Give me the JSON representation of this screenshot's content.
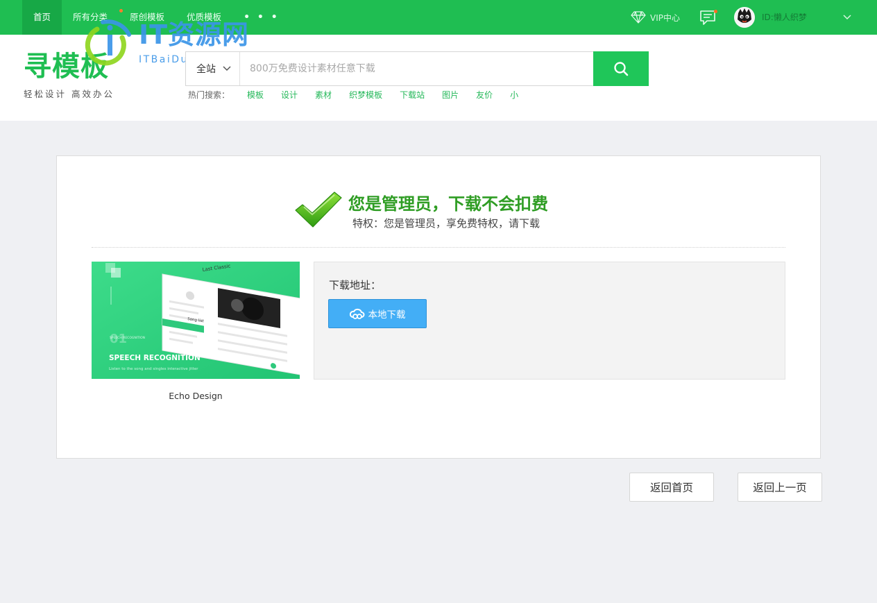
{
  "topnav": {
    "items": [
      "首页",
      "所有分类",
      "原创模板",
      "优质模板"
    ],
    "more": "• • •",
    "vip_label": "VIP中心",
    "user_id": "ID:懒人织梦"
  },
  "header": {
    "logo_title": "寻模板",
    "logo_slogan": "轻松设计 高效办公",
    "watermark_title": "IT资源网",
    "watermark_sub": "ITBaiDu.com",
    "search_scope": "全站",
    "search_placeholder": "800万免费设计素材任意下载",
    "hot_label": "热门搜索：",
    "hot_links": [
      "模板",
      "设计",
      "素材",
      "织梦模板",
      "下载站",
      "图片",
      "友价",
      "小"
    ]
  },
  "notice": {
    "title": "您是管理员，下载不会扣费",
    "subtitle": "特权：您是管理员，享免费特权，请下载"
  },
  "item": {
    "thumb_heading": "SPEECH RECOGNITION",
    "thumb_small": "SPEECH RECOGNITION",
    "thumb_number": "01",
    "thumb_tagline": "Listen to the song and singles interactive jitter",
    "thumb_screen_title": "Last Classic",
    "thumb_screen_song": "Song list",
    "caption": "Echo Design"
  },
  "download": {
    "label": "下载地址：",
    "button": "本地下载"
  },
  "footer": {
    "back_home": "返回首页",
    "back_prev": "返回上一页"
  },
  "colors": {
    "brand_green": "#1fbe52",
    "notice_green": "#2f9d24",
    "download_blue": "#43aef6",
    "watermark_blue": "#3b95e8"
  },
  "icons": [
    "diamond-icon",
    "message-icon",
    "avatar",
    "chevron-down-icon",
    "search-icon",
    "checkmark-icon",
    "cloud-link-icon"
  ]
}
